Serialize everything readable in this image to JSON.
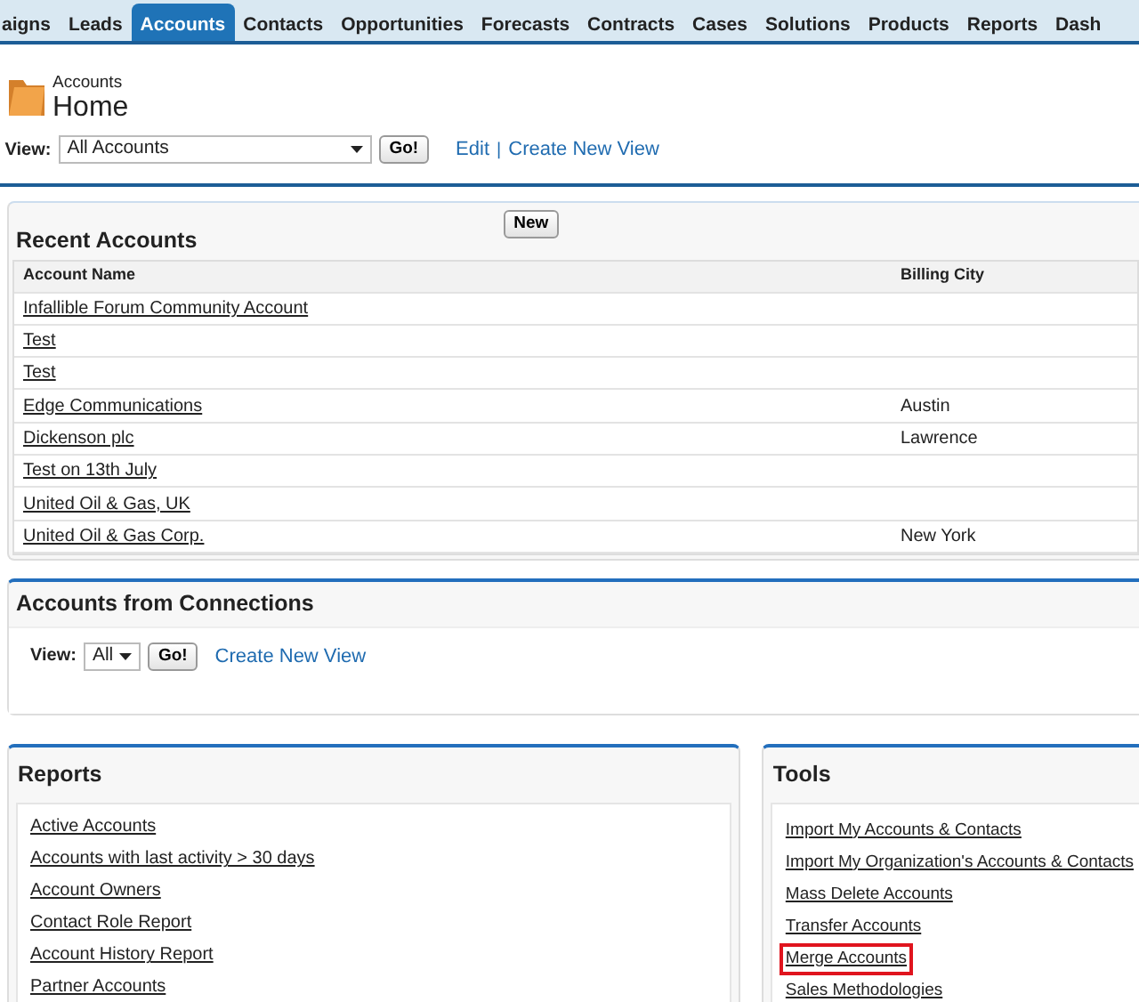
{
  "tabs": [
    {
      "label": "aigns",
      "selected": false
    },
    {
      "label": "Leads",
      "selected": false
    },
    {
      "label": "Accounts",
      "selected": true
    },
    {
      "label": "Contacts",
      "selected": false
    },
    {
      "label": "Opportunities",
      "selected": false
    },
    {
      "label": "Forecasts",
      "selected": false
    },
    {
      "label": "Contracts",
      "selected": false
    },
    {
      "label": "Cases",
      "selected": false
    },
    {
      "label": "Solutions",
      "selected": false
    },
    {
      "label": "Products",
      "selected": false
    },
    {
      "label": "Reports",
      "selected": false
    },
    {
      "label": "Dash",
      "selected": false
    }
  ],
  "header": {
    "breadcrumb": "Accounts",
    "title": "Home"
  },
  "view": {
    "label": "View:",
    "value": "All Accounts",
    "go": "Go!",
    "edit_link": "Edit",
    "separator": "|",
    "create_link": "Create New View"
  },
  "recent_accounts": {
    "title": "Recent Accounts",
    "new_button": "New",
    "columns": [
      "Account Name",
      "Billing City"
    ],
    "rows": [
      {
        "name": "Infallible Forum Community Account",
        "city": ""
      },
      {
        "name": "Test",
        "city": ""
      },
      {
        "name": "Test",
        "city": ""
      },
      {
        "name": "Edge Communications",
        "city": "Austin"
      },
      {
        "name": "Dickenson plc",
        "city": "Lawrence"
      },
      {
        "name": "Test on 13th July",
        "city": ""
      },
      {
        "name": "United Oil & Gas, UK",
        "city": ""
      },
      {
        "name": "United Oil & Gas Corp.",
        "city": "New York"
      }
    ]
  },
  "connections": {
    "title": "Accounts from Connections",
    "view_label": "View:",
    "view_value": "All",
    "go": "Go!",
    "create_link": "Create New View"
  },
  "reports": {
    "title": "Reports",
    "links": [
      "Active Accounts",
      "Accounts with last activity > 30 days",
      "Account Owners",
      "Contact Role Report",
      "Account History Report",
      "Partner Accounts"
    ]
  },
  "tools": {
    "title": "Tools",
    "links": [
      {
        "label": "Import My Accounts & Contacts",
        "highlighted": false
      },
      {
        "label": "Import My Organization's Accounts & Contacts",
        "highlighted": false
      },
      {
        "label": "Mass Delete Accounts",
        "highlighted": false
      },
      {
        "label": "Transfer Accounts",
        "highlighted": false
      },
      {
        "label": "Merge Accounts",
        "highlighted": true
      },
      {
        "label": "Sales Methodologies",
        "highlighted": false
      }
    ]
  }
}
